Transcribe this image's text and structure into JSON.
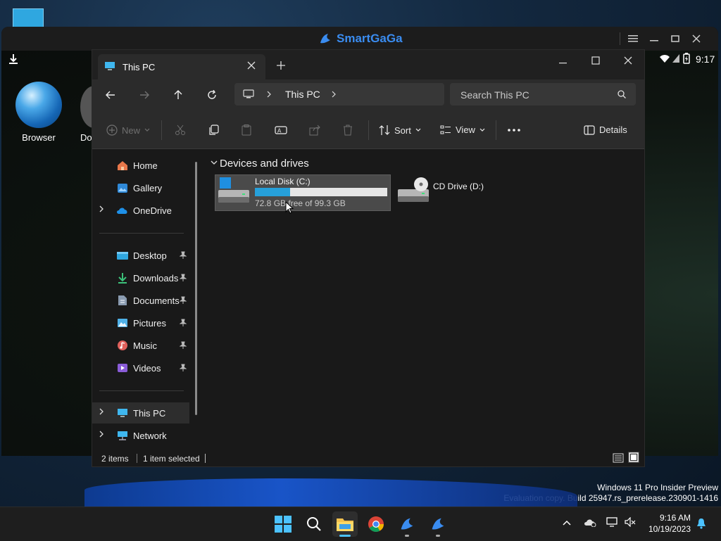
{
  "emulator": {
    "brand": "SmartGaGa",
    "status_time": "9:17"
  },
  "desktop_icons": [
    {
      "label": "Browser"
    },
    {
      "label": "Do"
    }
  ],
  "explorer": {
    "tab_title": "This PC",
    "breadcrumb": [
      "This PC"
    ],
    "search_placeholder": "Search This PC",
    "toolbar": {
      "new": "New",
      "sort": "Sort",
      "view": "View",
      "details": "Details"
    },
    "sidebar": {
      "group1": [
        {
          "label": "Home",
          "icon": "home-icon"
        },
        {
          "label": "Gallery",
          "icon": "gallery-icon"
        },
        {
          "label": "OneDrive",
          "icon": "onedrive-icon",
          "expandable": true
        }
      ],
      "group2": [
        {
          "label": "Desktop",
          "icon": "desktop-folder-icon"
        },
        {
          "label": "Downloads",
          "icon": "downloads-icon"
        },
        {
          "label": "Documents",
          "icon": "documents-icon"
        },
        {
          "label": "Pictures",
          "icon": "pictures-icon"
        },
        {
          "label": "Music",
          "icon": "music-icon"
        },
        {
          "label": "Videos",
          "icon": "videos-icon"
        }
      ],
      "group3": [
        {
          "label": "This PC",
          "icon": "this-pc-icon",
          "selected": true
        },
        {
          "label": "Network",
          "icon": "network-icon"
        }
      ]
    },
    "section_header": "Devices and drives",
    "drives": [
      {
        "name": "Local Disk (C:)",
        "free_text": "72.8 GB free of 99.3 GB",
        "used_fraction": 0.267,
        "selected": true
      },
      {
        "name": "CD Drive (D:)"
      }
    ],
    "status": {
      "items": "2 items",
      "selected": "1 item selected"
    }
  },
  "watermark": {
    "line1": "Windows 11 Pro Insider Preview",
    "line2": "Evaluation copy. Build 25947.rs_prerelease.230901-1416"
  },
  "taskbar": {
    "time": "9:16 AM",
    "date": "10/19/2023"
  },
  "colors": {
    "accent": "#4cc2ff",
    "selection": "#383838",
    "drive_bar": "#26a0da"
  }
}
